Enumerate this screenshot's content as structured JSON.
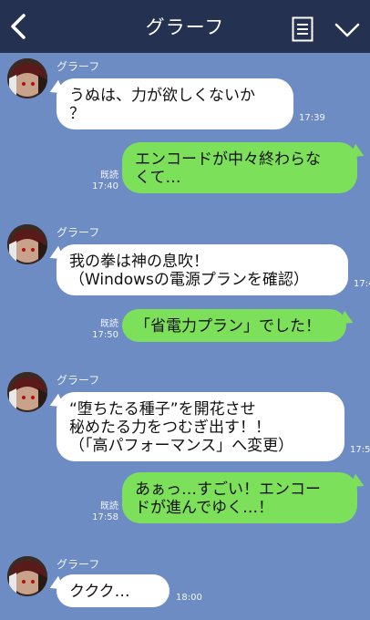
{
  "header": {
    "title": "グラーフ",
    "back_icon": "chevron-left-icon",
    "menu_icon": "notes-icon",
    "expand_icon": "chevron-down-icon",
    "bg_color": "#243150"
  },
  "chat": {
    "bg_color": "#6e8cc4",
    "incoming_bubble_color": "#ffffff",
    "outgoing_bubble_color": "#7de05a",
    "messages": [
      {
        "direction": "incoming",
        "sender": "グラーフ",
        "text": "うぬは、力が欲しくないか\n？",
        "time": "17:39"
      },
      {
        "direction": "outgoing",
        "text": "エンコードが中々終わらな\nくて…",
        "read": "既読",
        "time": "17:40"
      },
      {
        "direction": "incoming",
        "sender": "グラーフ",
        "text": "我の拳は神の息吹！\n（Windowsの電源プランを確認）",
        "time": "17:4"
      },
      {
        "direction": "outgoing",
        "text": "「省電力プラン」でした！",
        "read": "既読",
        "time": "17:50"
      },
      {
        "direction": "incoming",
        "sender": "グラーフ",
        "text": "“堕ちたる種子”を開花させ\n秘めたる力をつむぎ出す！！\n（「高パフォーマンス」へ変更）",
        "time": "17:5"
      },
      {
        "direction": "outgoing",
        "text": "あぁっ…すごい！エンコー\nドが進んでゆく…！",
        "read": "既読",
        "time": "17:58"
      },
      {
        "direction": "incoming",
        "sender": "グラーフ",
        "text": "ククク…",
        "time": "18:00"
      }
    ]
  }
}
